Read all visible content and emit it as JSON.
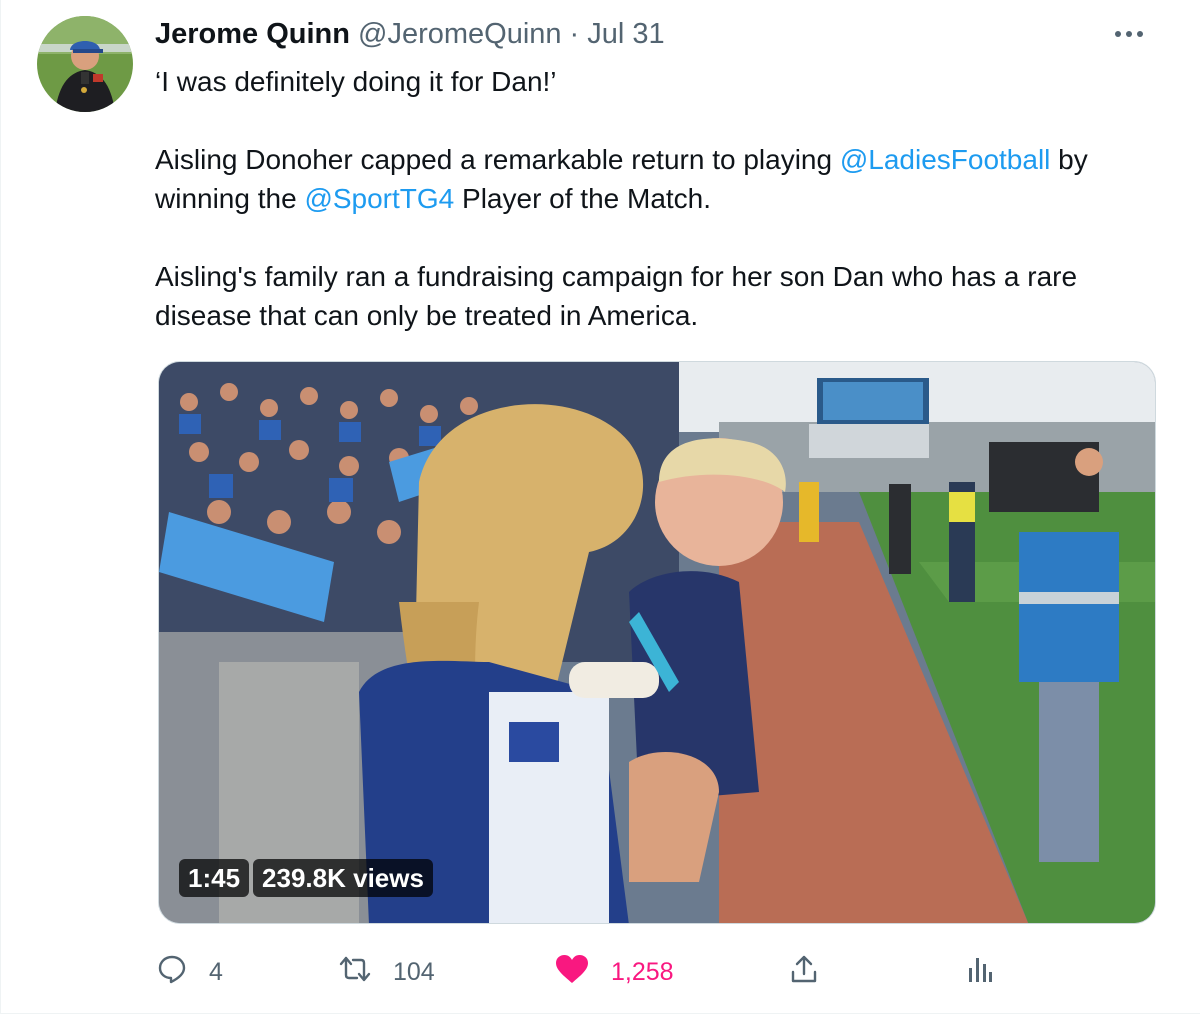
{
  "author": {
    "name": "Jerome Quinn",
    "handle": "@JeromeQuinn",
    "separator": "·",
    "date": "Jul 31",
    "avatar": "avatar-photo"
  },
  "tweet": {
    "line1": "‘I was definitely doing it for Dan!’",
    "p2_a": "Aisling Donoher capped a remarkable return to playing ",
    "p2_m1": "@LadiesFootball",
    "p2_b": " by winning the ",
    "p2_m2": "@SportTG4",
    "p2_c": " Player of the Match.",
    "p3": "Aisling's family ran a fundraising campaign for her son Dan who has a rare disease that can only be treated in America."
  },
  "media": {
    "duration": "1:45",
    "views": "239.8K views"
  },
  "actions": {
    "replies": "4",
    "retweets": "104",
    "likes": "1,258"
  },
  "colors": {
    "accent": "#1d9bf0",
    "like": "#f91880",
    "muted": "#536471",
    "text": "#0f1419"
  },
  "icons": [
    "more-icon",
    "reply-icon",
    "retweet-icon",
    "like-icon",
    "share-icon",
    "analytics-icon"
  ]
}
